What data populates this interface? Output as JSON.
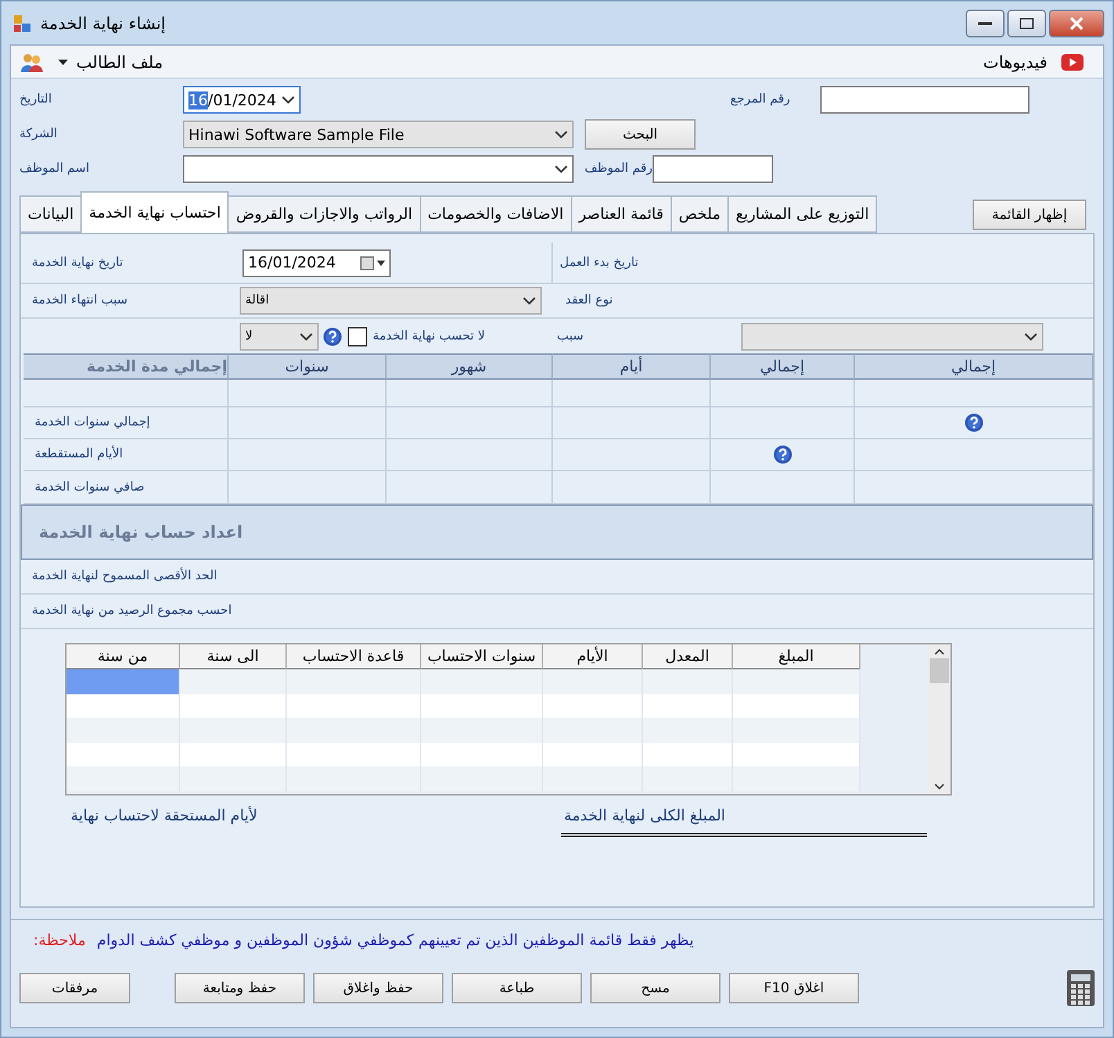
{
  "window": {
    "title": "إنشاء نهاية الخدمة"
  },
  "toolbar": {
    "student_file": "ملف الطالب",
    "videos": "فيديوهات"
  },
  "header": {
    "date_label": "التاريخ",
    "date_day": "16",
    "date_rest": "/01/2024",
    "reference_label": "رقم المرجع",
    "company_label": "الشركة",
    "company_value": "Hinawi Software Sample File",
    "search_button": "البحث",
    "employee_name_label": "اسم الموظف",
    "employee_number_label": "رقم الموظف"
  },
  "tabs": [
    {
      "label": "التوزيع على المشاريع",
      "selected": false
    },
    {
      "label": "ملخص",
      "selected": false
    },
    {
      "label": "قائمة العناصر",
      "selected": false
    },
    {
      "label": "الاضافات والخصومات",
      "selected": false
    },
    {
      "label": "الرواتب والاجازات والقروض",
      "selected": false
    },
    {
      "label": "احتساب نهاية الخدمة",
      "selected": true
    },
    {
      "label": "البيانات",
      "selected": false
    }
  ],
  "show_list_button": "إظهار القائمة",
  "service": {
    "end_date_label": "تاريخ نهاية الخدمة",
    "end_date_value": "16/01/2024",
    "start_date_label": "تاريخ بدء العمل",
    "end_reason_label": "سبب انتهاء الخدمة",
    "end_reason_value": "اقالة",
    "contract_type_label": "نوع العقد",
    "no_calc_label": "لا تحسب نهاية الخدمة",
    "no_calc_checked": false,
    "no_calc_value": "لا",
    "reason_label": "سبب"
  },
  "summary_table": {
    "columns": [
      "إجمالي",
      "إجمالي",
      "أيام",
      "شهور",
      "سنوات",
      "إجمالي مدة الخدمة"
    ],
    "rows": [
      {},
      {
        "label": "إجمالي سنوات الخدمة"
      },
      {
        "label": "الأيام المستقطعة"
      },
      {
        "label": "صافي سنوات الخدمة"
      }
    ]
  },
  "settings": {
    "title": "اعداد حساب نهاية الخدمة",
    "max_allowed_label": "الحد الأقصى المسموح لنهاية الخدمة",
    "calc_balance_label": "احسب مجموع الرصيد من نهاية الخدمة"
  },
  "grid": {
    "columns": [
      "المبلغ",
      "المعدل",
      "الأيام",
      "سنوات الاحتساب",
      "قاعدة الاحتساب",
      "الى سنة",
      "من سنة"
    ],
    "rows": [
      {
        "selected": true
      },
      {
        "selected": false
      },
      {
        "selected": false
      },
      {
        "selected": false
      },
      {
        "selected": false
      }
    ]
  },
  "days_due_label": "لأيام المستحقة لاحتساب نهاية",
  "total_amount_label": "المبلغ الكلى لنهاية الخدمة",
  "footer": {
    "note_label": "ملاحظة:",
    "note_text": "يظهر فقط قائمة الموظفين الذين تم تعيينهم كموظفي شؤون الموظفين و موظفي كشف الدوام",
    "buttons": [
      {
        "label": "اغلاق F10"
      },
      {
        "label": "مسح"
      },
      {
        "label": "طباعة"
      },
      {
        "label": "حفظ واغلاق"
      },
      {
        "label": "حفظ ومتابعة"
      },
      {
        "label": "مرفقات"
      }
    ]
  }
}
